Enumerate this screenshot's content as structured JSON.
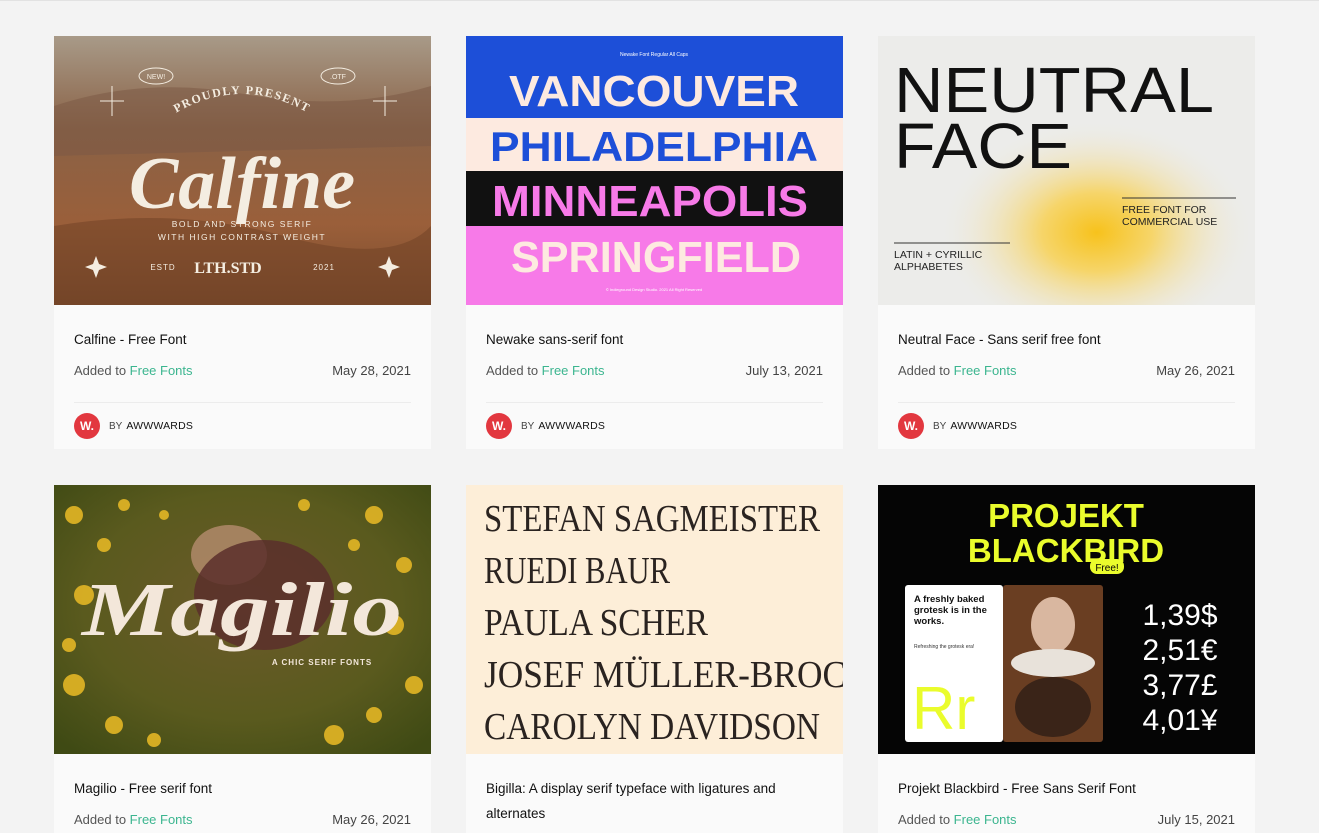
{
  "cards": [
    {
      "title": "Calfine - Free Font",
      "added_prefix": "Added to",
      "category": "Free Fonts",
      "date": "May 28, 2021",
      "by": "BY",
      "author": "AWWWARDS",
      "avatar": "W.",
      "image_text": {
        "badge_left": "NEW!",
        "badge_right": ".OTF",
        "arc": "PROUDLY PRESENT",
        "name": "Calfine",
        "sub1": "BOLD AND STRONG SERIF",
        "sub2": "WITH HIGH CONTRAST WEIGHT",
        "estd": "ESTD",
        "studio": "LTH.STD",
        "year": "2021"
      }
    },
    {
      "title": "Newake sans-serif font",
      "added_prefix": "Added to",
      "category": "Free Fonts",
      "date": "July 13, 2021",
      "by": "BY",
      "author": "AWWWARDS",
      "avatar": "W.",
      "image_text": {
        "header": "Newake Font Regular All Caps",
        "line1": "VANCOUVER",
        "line2": "PHILADELPHIA",
        "line3": "MINNEAPOLIS",
        "line4": "SPRINGFIELD",
        "footer": "© Indieground Design Studio. 2021 All Right Reserved"
      }
    },
    {
      "title": "Neutral Face - Sans serif free font",
      "added_prefix": "Added to",
      "category": "Free Fonts",
      "date": "May 26, 2021",
      "by": "BY",
      "author": "AWWWARDS",
      "avatar": "W.",
      "image_text": {
        "line1": "NEUTRAL",
        "line2": "FACE",
        "note1a": "FREE FONT FOR",
        "note1b": "COMMERCIAL USE",
        "note2a": "LATIN + CYRILLIC",
        "note2b": "ALPHABETES"
      }
    },
    {
      "title": "Magilio - Free serif font",
      "added_prefix": "Added to",
      "category": "Free Fonts",
      "date": "May 26, 2021",
      "image_text": {
        "name": "Magilio",
        "sub": "A CHIC SERIF FONTS"
      }
    },
    {
      "title": "Bigilla: A display serif typeface with ligatures and alternates",
      "image_text": {
        "line1": "STEFAN SAGMEISTER",
        "line2": "RUEDI BAUR",
        "line3": "PAULA SCHER",
        "line4": "JOSEF MÜLLER-BROC",
        "line5": "CAROLYN DAVIDSON"
      }
    },
    {
      "title": "Projekt Blackbird - Free Sans Serif Font",
      "added_prefix": "Added to",
      "category": "Free Fonts",
      "date": "July 15, 2021",
      "image_text": {
        "line1": "PROJEKT",
        "line2": "BLACKBIRD",
        "badge": "Free!",
        "card1": "A freshly baked",
        "card2": "grotesk is in the",
        "card3": "works.",
        "card4": "Refreshing the grotesk era!",
        "letters": "Rr",
        "p1": "1,39$",
        "p2": "2,51€",
        "p3": "3,77£",
        "p4": "4,01¥"
      }
    }
  ],
  "colors": {
    "accent": "#3bb58f",
    "avatar": "#e2373f"
  }
}
